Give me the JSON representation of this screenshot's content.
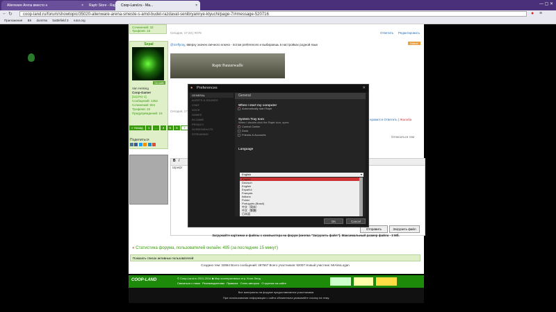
{
  "browser": {
    "tabs": [
      {
        "label": "Alienware Arena вместо н"
      },
      {
        "label": "Raptr Store - Raptr"
      },
      {
        "label": "Coop-Land.ru - Ма..."
      }
    ],
    "url": "coop-land.ru/forum/showtopic/35020-alienware-arena-smeste-s-amd-budet-razdavat-senibryannye-klyuchi/page-7/#message-520716",
    "bookmarks": [
      "Приложения",
      "ВК",
      "dom!No",
      "battlefield 3",
      "rutor.org"
    ]
  },
  "forum": {
    "prev_post": {
      "stat1": "Сочинений: 33",
      "stat2": "Трофеев: 15",
      "meta": "Сегодня, 17:23 | #479",
      "reply": "Ответить",
      "edit": "Редактировать"
    },
    "user": {
      "name": "Sepal",
      "status": "Онлайн",
      "rank": "Van Helsing",
      "group": "Coop-Gamer",
      "rep": "[11(2%)-1]",
      "posts": "Сообщений: 1352",
      "compositions": "Сочинений: 504",
      "trophies": "Трофеев: 22",
      "warnings": "Предупреждений: 16"
    },
    "post": {
      "mention": "@Iceflyray",
      "text": ", вверху значек гаечного ключа - потом preferences и выбираешь в настройках родной язык",
      "meta": "Сегодня, 17:23 | #480",
      "badge": "Новое",
      "actions": [
        "нравится",
        "Ответить",
        "| Жалоба"
      ],
      "signature": "Raptr Panzerwaffe"
    },
    "pagination": [
      "« Назад",
      "1",
      "...",
      "4",
      "5",
      "6",
      "7"
    ],
    "share_title": "Поделиться",
    "unsubscribe": "Отписаться тем",
    "editor_sample": "Шрифт",
    "send_button": "Отправить",
    "upload_button": "Загрузить файл",
    "upload_note": "Загружайте картинки и файлы с компьютера на форум (кнопка \"Загрузить файл\"). Максимальный размер файла - 3 Мб.",
    "stats_title": "Статистика форума, пользователей онлайн: 495 (за последние 15 минут)",
    "show_active": "Показать список активных пользователей",
    "stats_line": "Создано тем: 32864 Всего сообщений: 487567 Всего участников: 92007 Новый участник: MrAlexLogan",
    "footer_logo": "COOP-LAND",
    "footer_links": [
      "Связаться с нами",
      "Рекламодателям",
      "Правила",
      "Стать автором",
      "О группах на сайте"
    ],
    "footer_top": "© Coop-Land.ru 2011-2014 ◆ Мир кооперативных игр, Кооп-Ленд",
    "footer_note1": "Все материалы на форуме предоставляются участниками.",
    "footer_note2": "При использовании информации с сайта обязательна указывайте ссылку на тему."
  },
  "dialog": {
    "title": "Preferences",
    "sidebar": [
      "GENERAL",
      "ALERTS & SOUNDS",
      "CHAT",
      "DOCK",
      "GAMES",
      "IN-GAME",
      "PRIVACY",
      "SCREENSHOTS",
      "STREAMING"
    ],
    "section": "General",
    "startup": {
      "label": "When I start my computer",
      "options": [
        {
          "label": "Automatically start Raptr",
          "checked": true
        }
      ]
    },
    "tray": {
      "label": "System Tray Icon",
      "desc": "When I double-click the Raptr icon, open:",
      "options": [
        {
          "label": "Control Center",
          "checked": true
        },
        {
          "label": "Dock",
          "checked": false
        },
        {
          "label": "Friends & Accounts",
          "checked": false
        }
      ]
    },
    "language": {
      "label": "Language",
      "selected": "English",
      "options": [
        "English",
        "Deutsch",
        "English",
        "Español",
        "Français",
        "Italiano",
        "Polski",
        "Português (Brasil)",
        "中文（简体）",
        "中文（繁體）",
        "日本語"
      ]
    },
    "ok": "OK",
    "cancel": "Cancel"
  }
}
